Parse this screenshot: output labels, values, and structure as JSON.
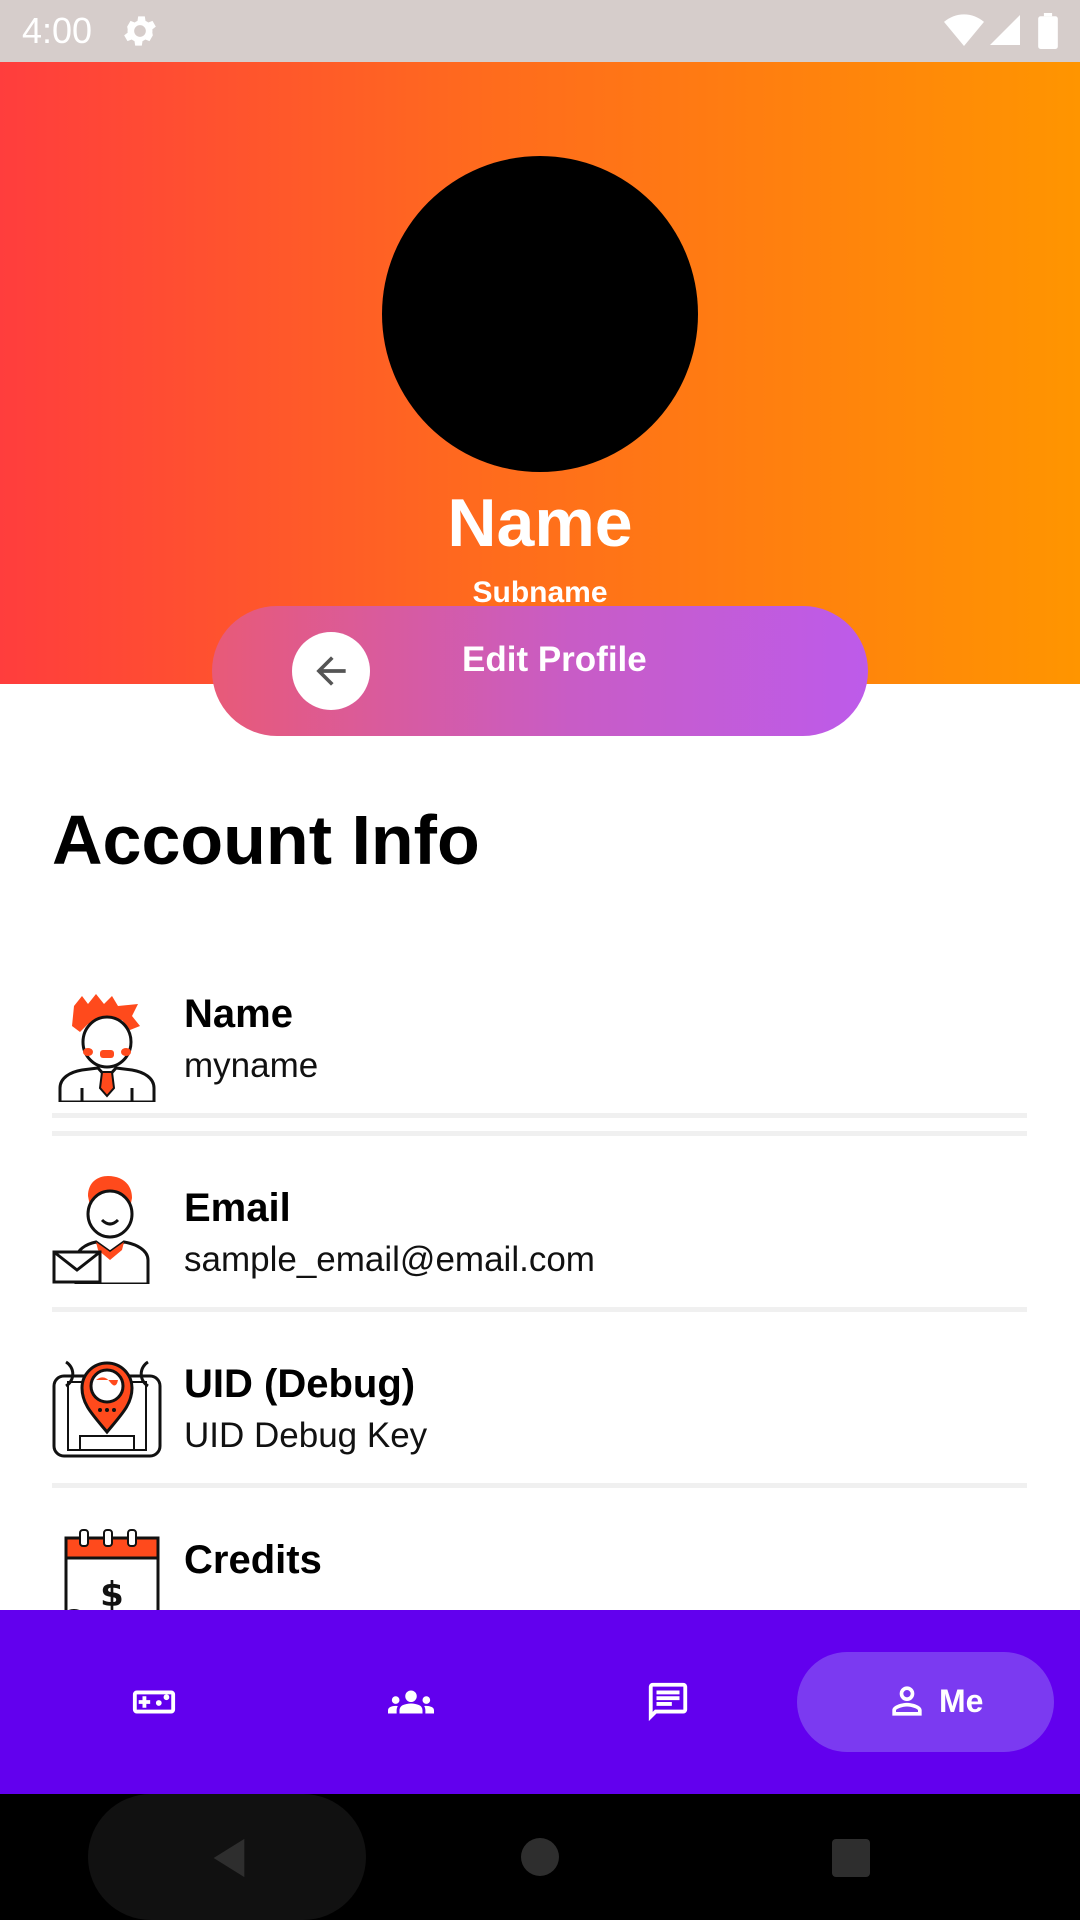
{
  "status_bar": {
    "time": "4:00"
  },
  "profile": {
    "name": "Name",
    "subname": "Subname",
    "edit_button_label": "Edit Profile"
  },
  "account_info": {
    "title": "Account Info",
    "items": [
      {
        "label": "Name",
        "value": "myname",
        "icon": "person-avatar-icon"
      },
      {
        "label": "Email",
        "value": "sample_email@email.com",
        "icon": "email-person-icon"
      },
      {
        "label": "UID (Debug)",
        "value": "UID Debug Key",
        "icon": "location-pin-device-icon"
      },
      {
        "label": "Credits",
        "value": "",
        "icon": "calendar-payment-icon"
      }
    ]
  },
  "bottom_nav": {
    "items": [
      {
        "icon": "gamepad-icon",
        "label": ""
      },
      {
        "icon": "groups-icon",
        "label": ""
      },
      {
        "icon": "chat-icon",
        "label": ""
      },
      {
        "icon": "person-icon",
        "label": "Me",
        "selected": true
      }
    ]
  },
  "colors": {
    "hero_gradient_start": "#ff3d3d",
    "hero_gradient_end": "#ff9500",
    "edit_button_start": "#e85a78",
    "edit_button_end": "#bd5bea",
    "nav_background": "#6200ee",
    "nav_selected_pill": "#7b3af1",
    "status_bar": "#d6cdcb"
  }
}
